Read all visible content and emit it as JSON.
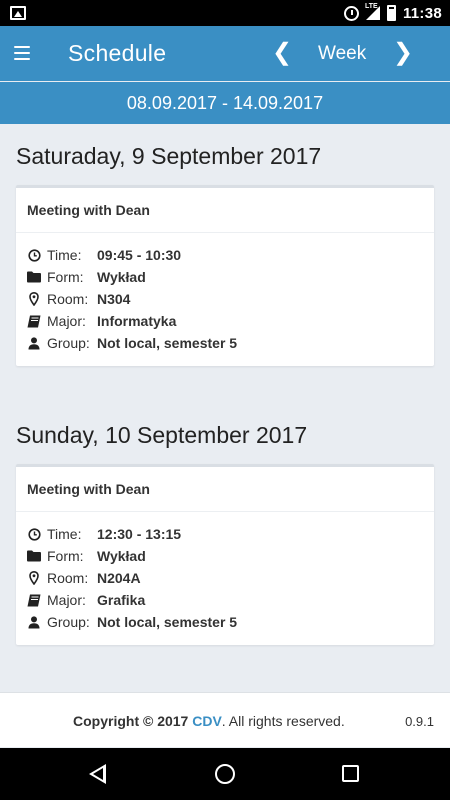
{
  "statusbar": {
    "network": "LTE",
    "time": "11:38"
  },
  "appbar": {
    "title": "Schedule",
    "view_label": "Week",
    "prev_glyph": "❮",
    "next_glyph": "❯"
  },
  "date_range": "08.09.2017 - 14.09.2017",
  "labels": {
    "time": "Time:",
    "form": "Form:",
    "room": "Room:",
    "major": "Major:",
    "group": "Group:"
  },
  "days": [
    {
      "heading": "Saturaday, 9 September 2017",
      "event": {
        "title": "Meeting with Dean",
        "time": "09:45 - 10:30",
        "form": "Wykład",
        "room": "N304",
        "major": "Informatyka",
        "group": "Not local, semester 5"
      }
    },
    {
      "heading": "Sunday, 10 September 2017",
      "event": {
        "title": "Meeting with Dean",
        "time": "12:30 - 13:15",
        "form": "Wykład",
        "room": "N204A",
        "major": "Grafika",
        "group": "Not local, semester 5"
      }
    }
  ],
  "footer": {
    "copyright_prefix": "Copyright © 2017",
    "brand": "CDV",
    "copyright_suffix": ". All rights reserved.",
    "version": "0.9.1"
  },
  "colors": {
    "primary": "#3a8fc4",
    "background": "#e9edf2"
  }
}
